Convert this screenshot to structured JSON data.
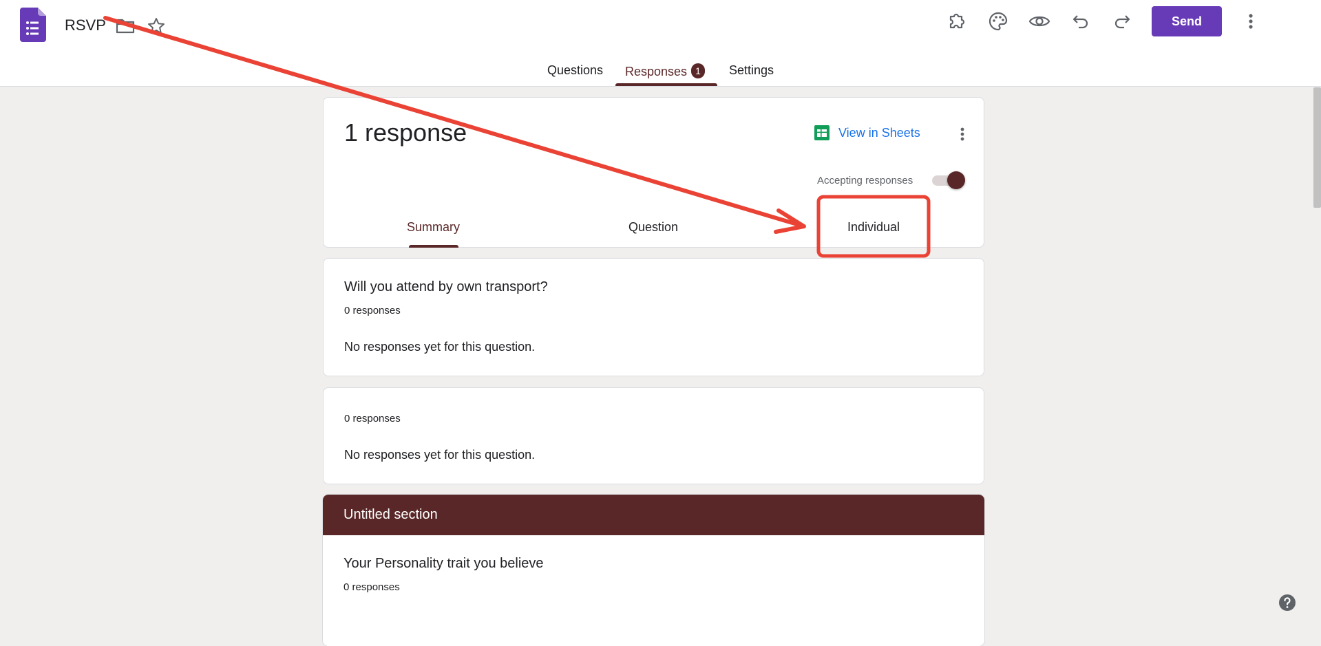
{
  "header": {
    "title": "RSVP",
    "send_label": "Send",
    "icons": [
      "forms-logo-icon",
      "folder-icon",
      "star-icon",
      "addon-puzzle-icon",
      "palette-icon",
      "preview-eye-icon",
      "undo-icon",
      "redo-icon",
      "more-vert-icon"
    ],
    "brand_color": "#673ab7"
  },
  "tabs": {
    "questions": "Questions",
    "responses": "Responses",
    "responses_badge": "1",
    "settings": "Settings"
  },
  "summary": {
    "response_count": "1 response",
    "view_in_sheets": "View in Sheets",
    "accepting_label": "Accepting responses",
    "accepting_on": true,
    "subtabs": {
      "summary": "Summary",
      "question": "Question",
      "individual": "Individual"
    }
  },
  "questions": [
    {
      "title": "Will you attend by own transport?",
      "count": "0 responses",
      "empty": "No responses yet for this question."
    },
    {
      "title": "",
      "count": "0 responses",
      "empty": "No responses yet for this question."
    }
  ],
  "section": {
    "title": "Untitled section",
    "question_title": "Your Personality trait you believe",
    "question_count": "0 responses"
  },
  "theme": {
    "accent": "#5a2728",
    "link": "#1a73e8",
    "annotation": "#ea4335"
  }
}
